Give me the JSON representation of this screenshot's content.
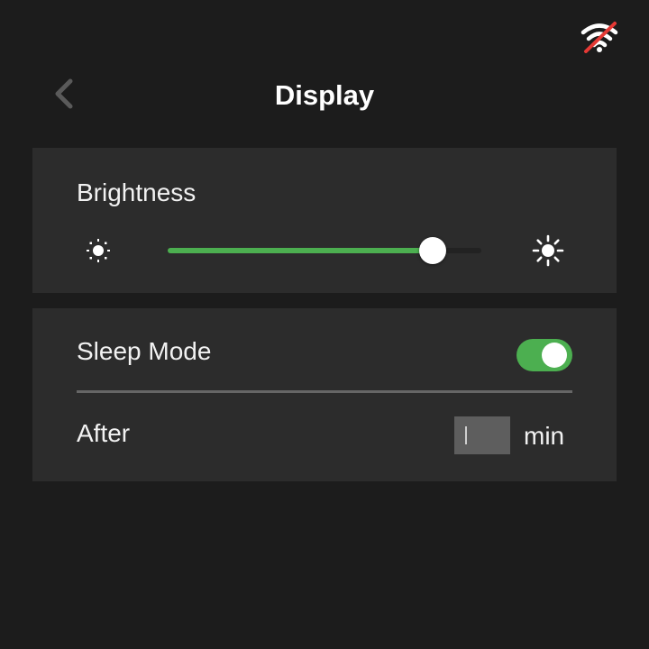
{
  "header": {
    "title": "Display",
    "back_icon": "chevron-left-icon",
    "status_icon": "wifi-off-icon"
  },
  "brightness": {
    "label": "Brightness",
    "value_fraction": 0.845,
    "min_icon": "sun-low-icon",
    "max_icon": "sun-high-icon"
  },
  "sleep": {
    "label": "Sleep Mode",
    "enabled": true,
    "after_label": "After",
    "after_value": "",
    "unit": "min"
  },
  "colors": {
    "background": "#1c1c1c",
    "card": "#2c2c2c",
    "accent": "#4caf50",
    "wifi_slash": "#e53935",
    "input_bg": "#5e5e5e"
  }
}
